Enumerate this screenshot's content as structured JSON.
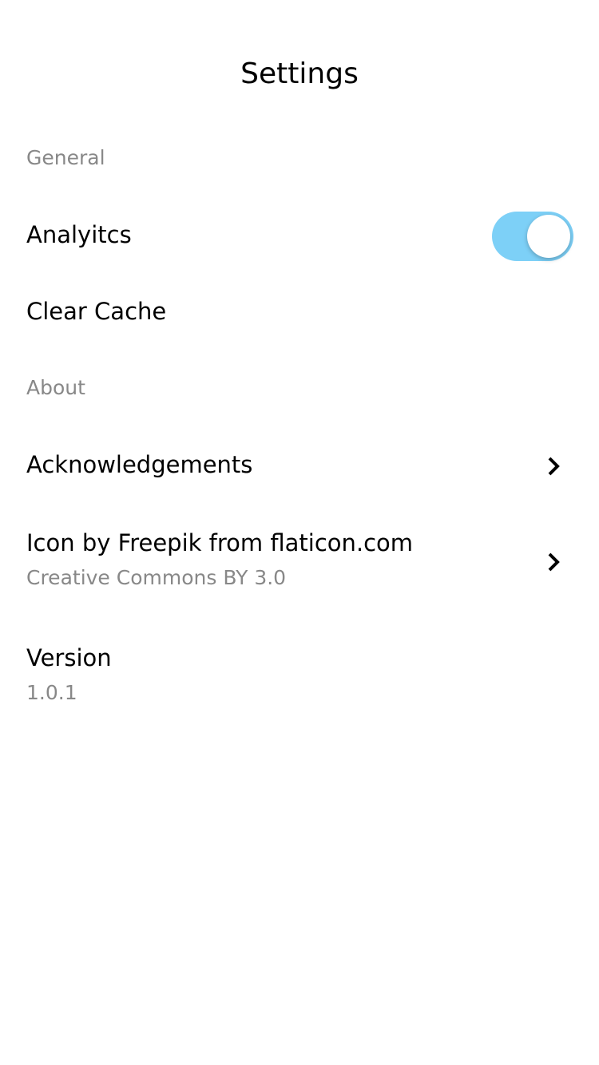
{
  "header": {
    "title": "Settings"
  },
  "sections": {
    "general": "General",
    "about": "About"
  },
  "items": {
    "analytics": {
      "label": "Analyitcs",
      "enabled": true
    },
    "clear_cache": "Clear Cache",
    "acknowledgements": "Acknowledgements",
    "icon_credit": {
      "label": "Icon by Freepik from flaticon.com",
      "sub": "Creative Commons BY 3.0"
    },
    "version": {
      "label": "Version",
      "value": "1.0.1"
    }
  },
  "colors": {
    "toggle_on": "#7dd0f7"
  },
  "icons": {
    "chevron": "chevron-right-icon"
  }
}
